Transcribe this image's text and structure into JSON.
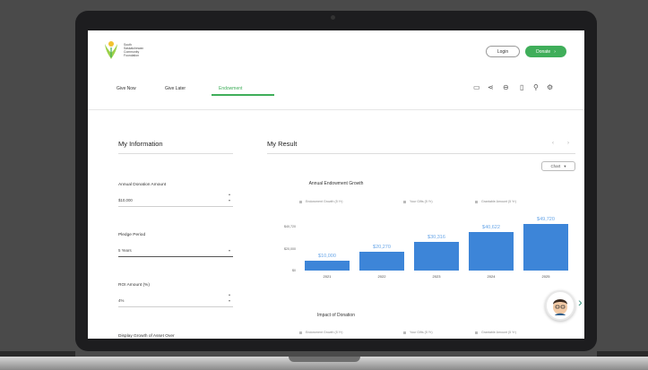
{
  "header": {
    "logo_lines": [
      "South",
      "Saskatchewan",
      "Community",
      "Foundation"
    ],
    "login_label": "Login",
    "donate_label": "Donate"
  },
  "nav": {
    "items": [
      {
        "label": "Give Now"
      },
      {
        "label": "Give Later"
      },
      {
        "label": "Endowment"
      }
    ]
  },
  "toolbar": {
    "icons": [
      "bookmark-icon",
      "share-icon",
      "print-icon",
      "expand-icon",
      "search-icon",
      "settings-icon"
    ]
  },
  "left_panel": {
    "title": "My Information",
    "fields": [
      {
        "label": "Annual Donation Amount",
        "value": "$10,000"
      },
      {
        "label": "Pledge Period",
        "value": "5 Years"
      },
      {
        "label": "ROI Amount (%)",
        "value": "4%"
      },
      {
        "label": "Display Growth of Asset Over",
        "value": ""
      }
    ]
  },
  "right_panel": {
    "title": "My Result",
    "sort_label": "Chart",
    "impact_title": "Impact of Donation"
  },
  "chart_data": {
    "type": "bar",
    "title": "Annual Endowment Growth",
    "legend": [
      "Endowment Growth (5 Yr)",
      "Your Gifts (5 Yr)",
      "Grantable Amount (5 Yr)"
    ],
    "y_ticks": [
      "$40,720",
      "$20,000",
      "$0"
    ],
    "ylim": [
      0,
      55000
    ],
    "categories": [
      "2021",
      "2022",
      "2023",
      "2024",
      "2025"
    ],
    "values": [
      10000,
      20270,
      30316,
      40622,
      49720
    ],
    "value_labels": [
      "$10,000",
      "$20,270",
      "$30,316",
      "$40,622",
      "$49,720"
    ]
  },
  "colors": {
    "accent": "#3fae5a",
    "bar": "#3d85d8"
  }
}
